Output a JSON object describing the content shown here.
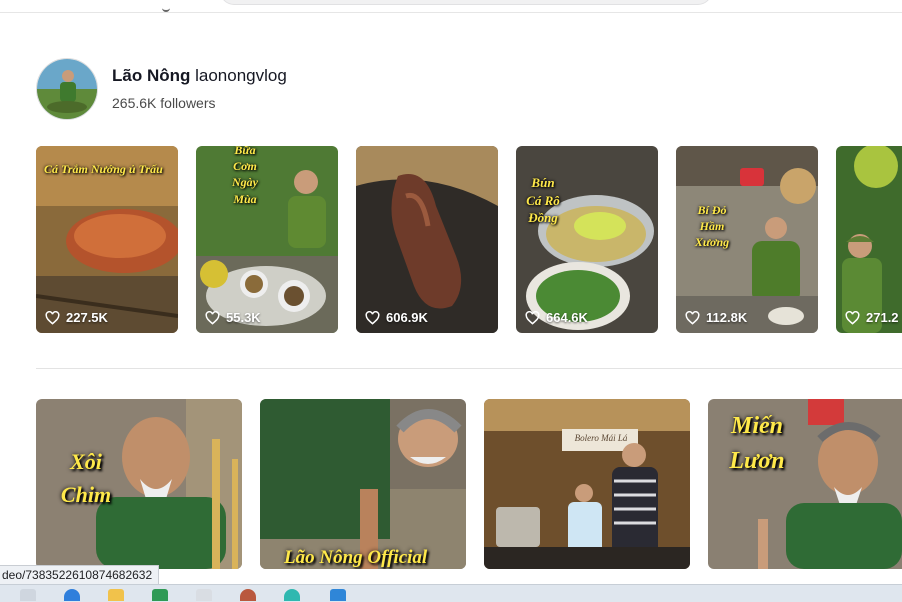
{
  "creator": {
    "display_name": "Lão Nông",
    "handle": "laonongvlog",
    "followers": "265.6K followers"
  },
  "videos": [
    {
      "caption": "Cá Trắm Nướng ủ Trấu",
      "likes": "227.5K"
    },
    {
      "caption": "Bữa Cơm Ngày Mùa",
      "likes": "55.3K"
    },
    {
      "caption": "",
      "likes": "606.9K"
    },
    {
      "caption": "Bún Cá Rô Đồng",
      "likes": "664.6K"
    },
    {
      "caption": "Bí Đỏ Hầm Xương",
      "likes": "112.8K"
    },
    {
      "caption": "",
      "likes": "271.2"
    }
  ],
  "related": [
    {
      "caption": "Xôi Chim"
    },
    {
      "caption": "Lão Nông Official"
    },
    {
      "caption": "Bolero Mái Lá"
    },
    {
      "caption": "Miến Lươn"
    }
  ],
  "status_url": "deo/7383522610874682632",
  "colors": {
    "caption_yellow": "#ffe94a",
    "text_primary": "#161823",
    "text_secondary": "#4a4a4a"
  }
}
